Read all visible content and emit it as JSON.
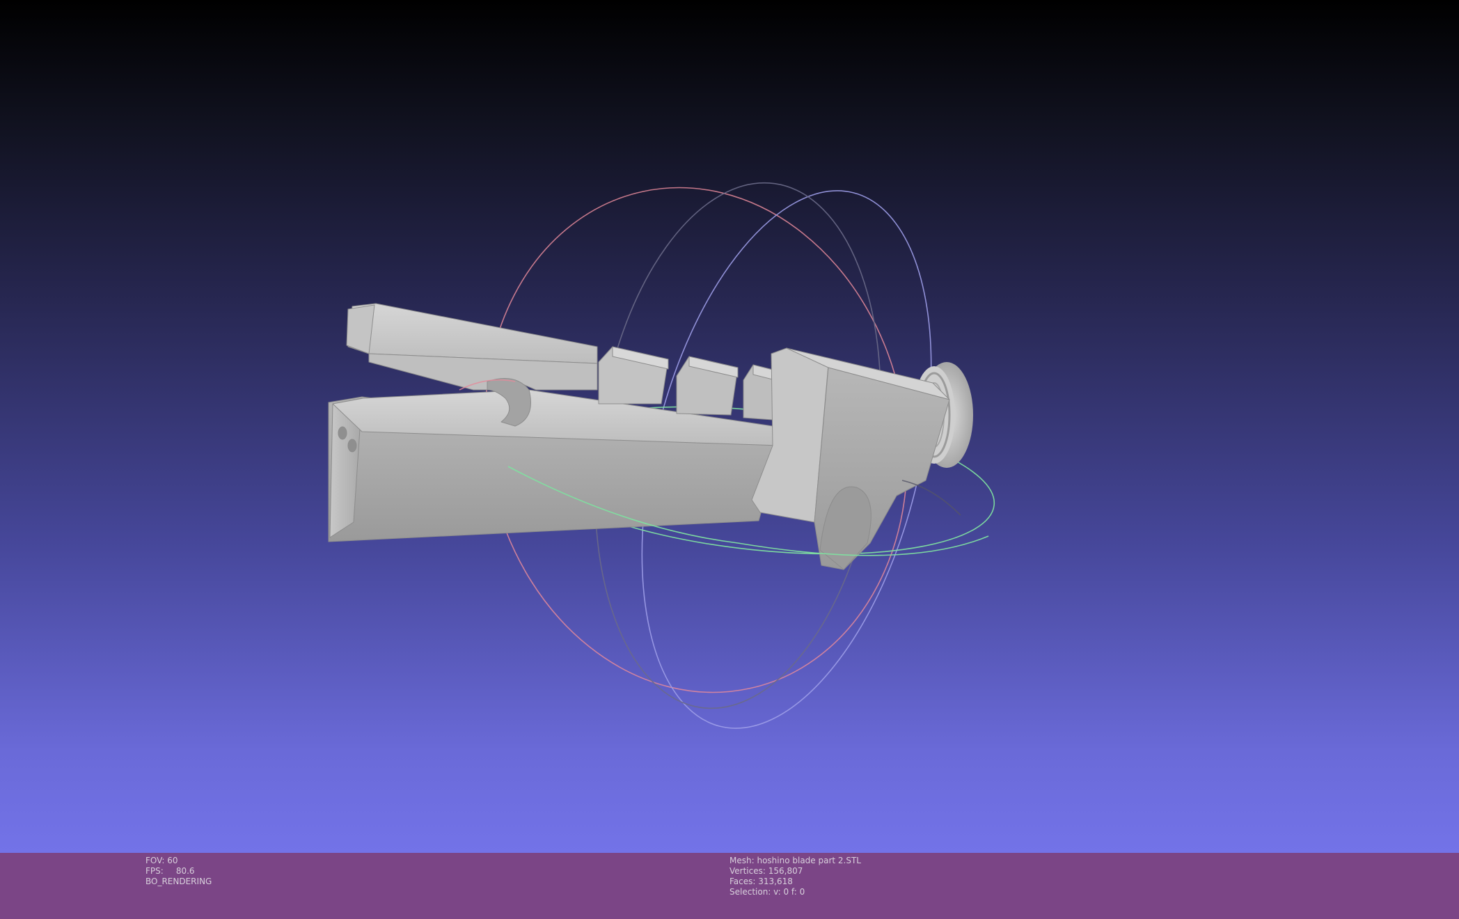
{
  "viewport": {
    "background_top": "#000000",
    "background_bottom": "#7373e8",
    "model_color": "#b9b9b9",
    "trackball_colors": {
      "x_axis": "#e58a9a",
      "y_axis": "#7fe0a0",
      "z_axis": "#9d9de8"
    }
  },
  "statusbar": {
    "background": "#7b4586",
    "fov_label": "FOV:",
    "fov_value": "60",
    "fps_label": "FPS:",
    "fps_value": "80.6",
    "render_mode": "BO_RENDERING",
    "mesh_label": "Mesh:",
    "mesh_name": "hoshino blade part 2.STL",
    "vertices_label": "Vertices:",
    "vertices_value": "156,807",
    "faces_label": "Faces:",
    "faces_value": "313,618",
    "selection_label": "Selection:",
    "selection_value": "v: 0 f: 0"
  }
}
